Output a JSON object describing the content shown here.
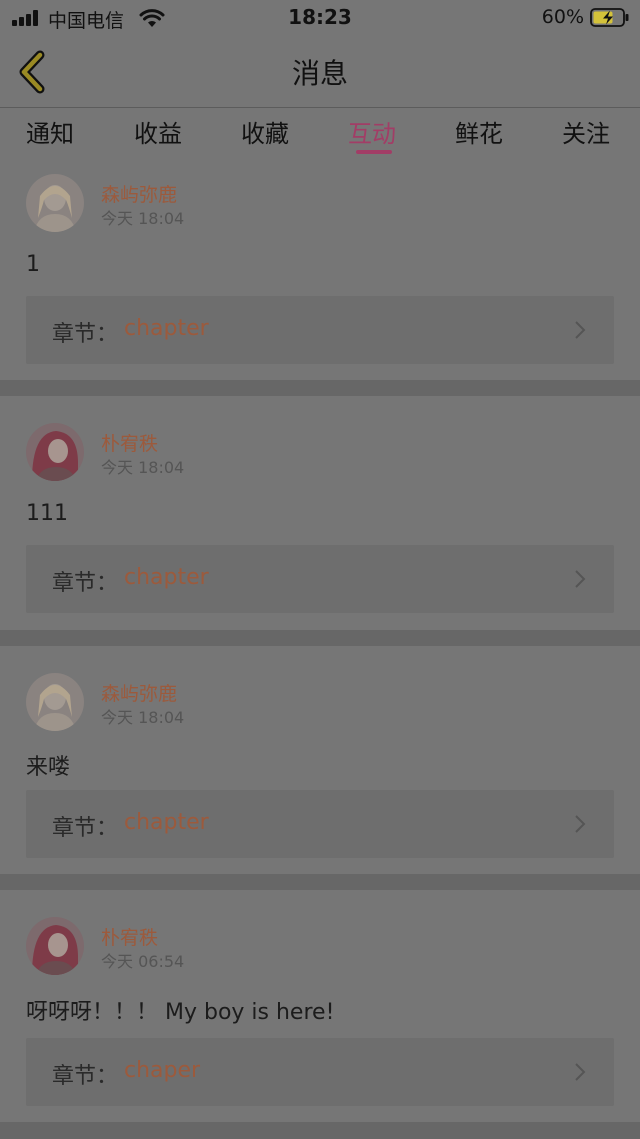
{
  "status_bar": {
    "carrier": "中国电信",
    "time": "18:23",
    "battery": "60%",
    "icons": [
      "signal-icon",
      "wifi-icon",
      "battery-charging-icon"
    ]
  },
  "nav": {
    "title": "消息",
    "back_icon": "chevron-left-icon"
  },
  "tabs": [
    {
      "label": "通知",
      "active": false
    },
    {
      "label": "收益",
      "active": false
    },
    {
      "label": "收藏",
      "active": false
    },
    {
      "label": "互动",
      "active": true
    },
    {
      "label": "鲜花",
      "active": false
    },
    {
      "label": "关注",
      "active": false
    }
  ],
  "chapter_prefix": "章节：",
  "messages": [
    {
      "user": "森屿弥鹿",
      "time": "今天 18:04",
      "text": "1",
      "chapter": "chapter"
    },
    {
      "user": "朴宥秩",
      "time": "今天 18:04",
      "text": "111",
      "chapter": "chapter"
    },
    {
      "user": "森屿弥鹿",
      "time": "今天 18:04",
      "text": "来喽",
      "chapter": "chapter"
    },
    {
      "user": "朴宥秩",
      "time": "今天 06:54",
      "text": "呀呀呀！！！ My boy is here!",
      "chapter": "chaper"
    }
  ],
  "colors": {
    "accent": "#a23d66",
    "username": "#9c5a3c",
    "overlay_background": "#676767"
  }
}
